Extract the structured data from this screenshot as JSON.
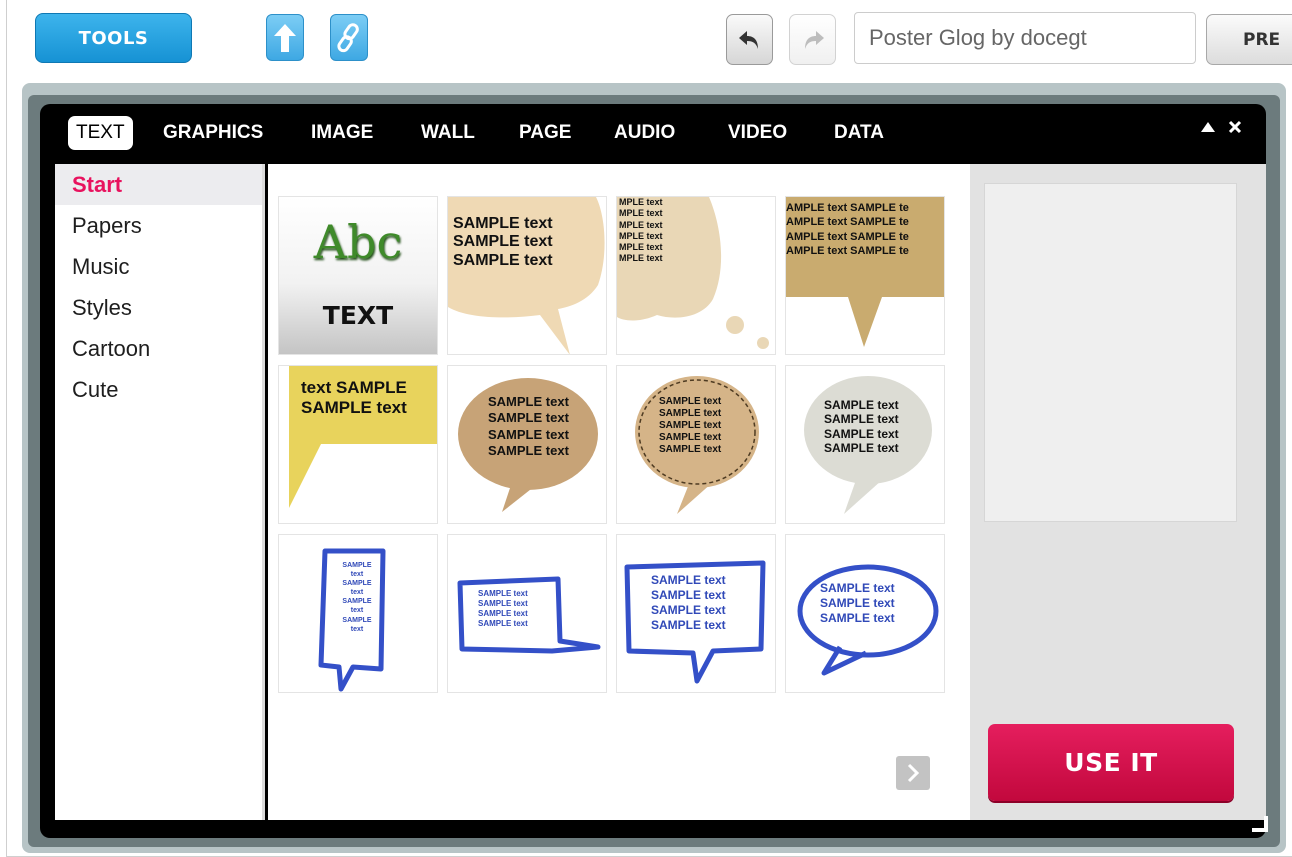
{
  "toolbar": {
    "tools_label": "TOOLS",
    "upload_icon": "arrow-up-icon",
    "link_icon": "link-icon",
    "undo_icon": "undo-icon",
    "redo_icon": "redo-icon",
    "title_value": "Poster Glog by docegt",
    "preview_label": "PRE"
  },
  "panel": {
    "tabs": [
      {
        "label": "TEXT",
        "active": true
      },
      {
        "label": "GRAPHICS"
      },
      {
        "label": "IMAGE"
      },
      {
        "label": "WALL"
      },
      {
        "label": "PAGE"
      },
      {
        "label": "AUDIO"
      },
      {
        "label": "VIDEO"
      },
      {
        "label": "DATA"
      }
    ],
    "collapse_icon": "triangle-up-icon",
    "close_icon": "close-icon",
    "categories": [
      {
        "label": "Start",
        "active": true
      },
      {
        "label": "Papers"
      },
      {
        "label": "Music"
      },
      {
        "label": "Styles"
      },
      {
        "label": "Cartoon"
      },
      {
        "label": "Cute"
      }
    ],
    "thumbs": {
      "t1": {
        "abc": "Abc",
        "label": "TEXT"
      },
      "t2": {
        "lines": [
          "SAMPLE text",
          "SAMPLE text",
          "SAMPLE text"
        ]
      },
      "t3": {
        "lines": [
          "MPLE text",
          "MPLE text",
          "MPLE text",
          "MPLE text",
          "MPLE text",
          "MPLE text"
        ]
      },
      "t4": {
        "lines": [
          "AMPLE text SAMPLE te",
          "AMPLE text SAMPLE te",
          "AMPLE text SAMPLE te",
          "AMPLE text SAMPLE te"
        ]
      },
      "t5": {
        "lines": [
          "text SAMPLE",
          "SAMPLE text"
        ]
      },
      "t6": {
        "lines": [
          "SAMPLE text",
          "SAMPLE text",
          "SAMPLE text",
          "SAMPLE text"
        ]
      },
      "t7": {
        "lines": [
          "SAMPLE text",
          "SAMPLE text",
          "SAMPLE text",
          "SAMPLE text",
          "SAMPLE text"
        ]
      },
      "t8": {
        "lines": [
          "SAMPLE text",
          "SAMPLE text",
          "SAMPLE text",
          "SAMPLE text"
        ]
      },
      "t9": {
        "lines": [
          "SAMPLE",
          "text",
          "SAMPLE",
          "text",
          "SAMPLE",
          "text",
          "SAMPLE",
          "text"
        ]
      },
      "t10": {
        "lines": [
          "SAMPLE text",
          "SAMPLE text",
          "SAMPLE text",
          "SAMPLE text"
        ]
      },
      "t11": {
        "lines": [
          "SAMPLE text",
          "SAMPLE text",
          "SAMPLE text",
          "SAMPLE text"
        ]
      },
      "t12": {
        "lines": [
          "SAMPLE text",
          "SAMPLE text",
          "SAMPLE text"
        ]
      }
    },
    "next_icon": "chevron-right-icon",
    "use_it_label": "USE IT",
    "resize_icon": "resize-grip-icon"
  }
}
